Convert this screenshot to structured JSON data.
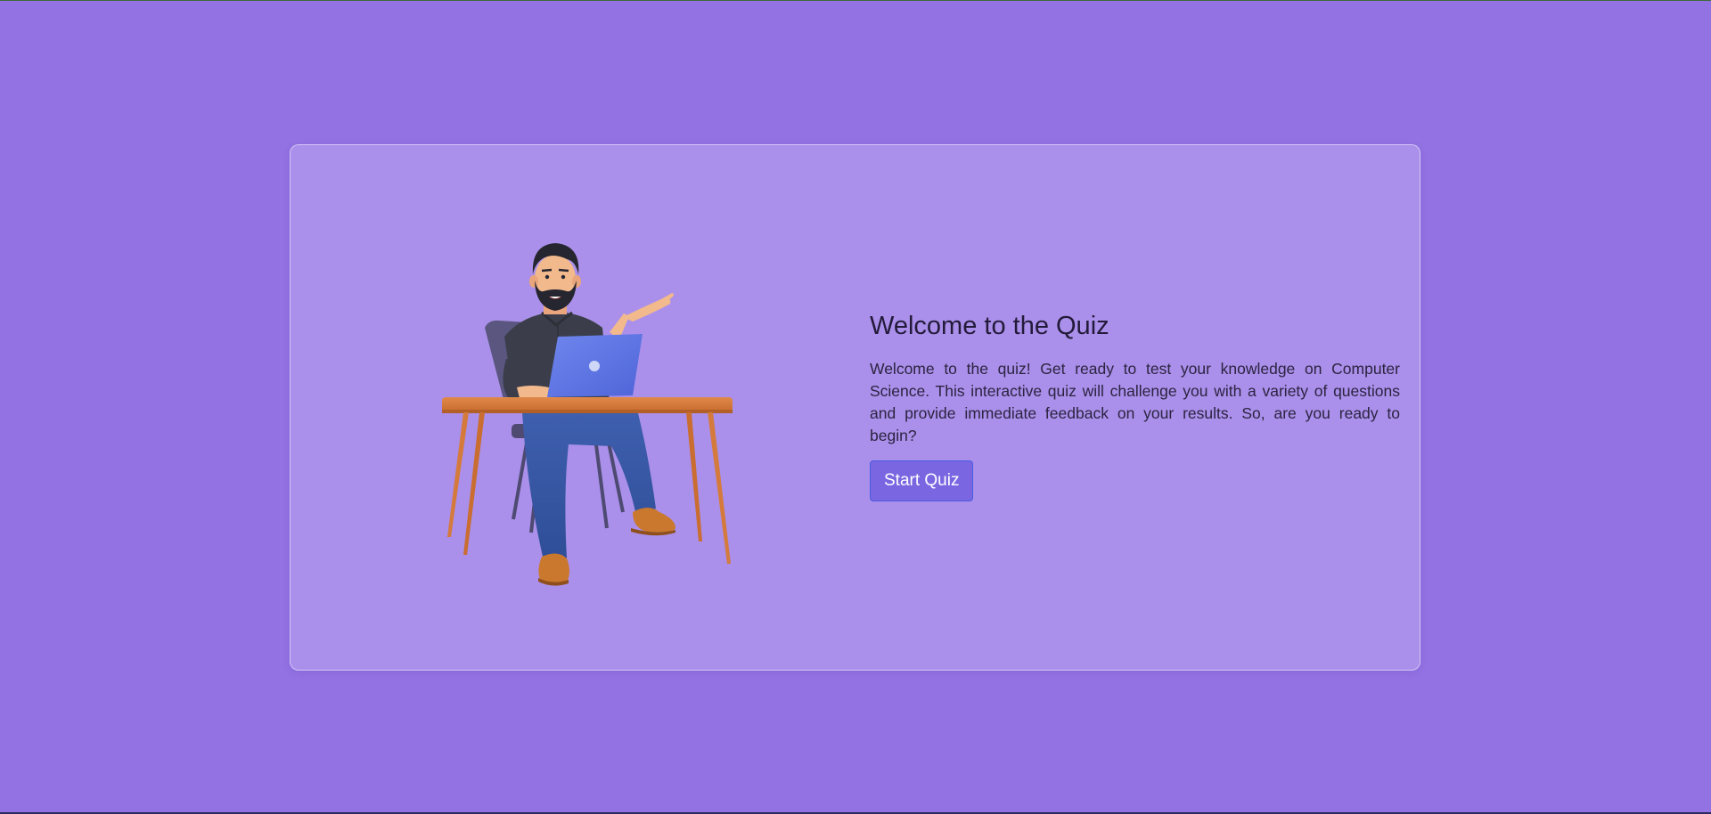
{
  "welcome": {
    "title": "Welcome to the Quiz",
    "description": "Welcome to the quiz! Get ready to test your knowledge on Computer Science. This interactive quiz will challenge you with a variety of questions and provide immediate feedback on your results. So, are you ready to begin?",
    "start_label": "Start Quiz"
  },
  "illustration": {
    "subject": "man-at-desk-with-laptop"
  },
  "colors": {
    "background": "#9372e3",
    "card": "#ac8fe9",
    "button": "#7b66e2",
    "button_border": "#4b5be0",
    "title_text": "#231a3a"
  }
}
